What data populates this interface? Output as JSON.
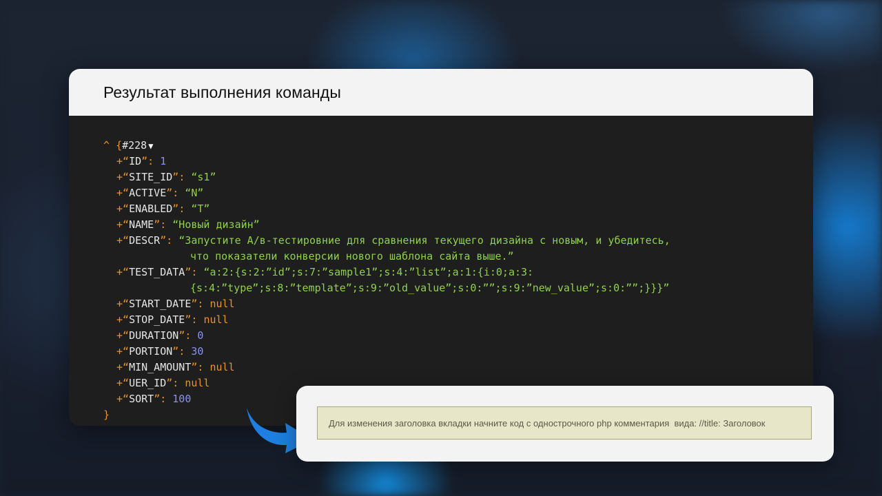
{
  "panel": {
    "title": "Результат выполнения команды"
  },
  "dump": {
    "caret": "^",
    "open_brace": "{",
    "object_id": "#228",
    "toggle": "▼",
    "close_brace": "}",
    "fields": [
      {
        "key": "ID",
        "type": "num",
        "value": "1"
      },
      {
        "key": "SITE_ID",
        "type": "str",
        "value": "“s1”"
      },
      {
        "key": "ACTIVE",
        "type": "str",
        "value": "“N”"
      },
      {
        "key": "ENABLED",
        "type": "str",
        "value": "“T”"
      },
      {
        "key": "NAME",
        "type": "str",
        "value": "“Новый дизайн”"
      },
      {
        "key": "DESCR",
        "type": "str",
        "value": "“Запустите А/в-тестировние для сравнения текущего дизайна с новым, и убедитесь,",
        "continuation": "что показатели конверсии нового шаблона сайта выше.”"
      },
      {
        "key": "TEST_DATA",
        "type": "str",
        "value": "“a:2:{s:2:”id”;s:7:”sample1”;s:4:”list”;a:1:{i:0;a:3:",
        "continuation": "{s:4:”type”;s:8:”template”;s:9:”old_value”;s:0:””;s:9:”new_value”;s:0:””;}}}”"
      },
      {
        "key": "START_DATE",
        "type": "null",
        "value": "null"
      },
      {
        "key": "STOP_DATE",
        "type": "null",
        "value": "null"
      },
      {
        "key": "DURATION",
        "type": "num",
        "value": "0"
      },
      {
        "key": "PORTION",
        "type": "num",
        "value": "30"
      },
      {
        "key": "MIN_AMOUNT",
        "type": "null",
        "value": "null"
      },
      {
        "key": "UER_ID",
        "type": "null",
        "value": "null"
      },
      {
        "key": "SORT",
        "type": "num",
        "value": "100"
      }
    ]
  },
  "note": {
    "text": "Для изменения заголовка вкладки начните код с однострочного php комментария  вида: //title: Заголовок"
  },
  "colors": {
    "arrow": "#1e7fe0",
    "string": "#8fd14f",
    "number": "#8a93ea",
    "punctuation": "#e9932f"
  }
}
